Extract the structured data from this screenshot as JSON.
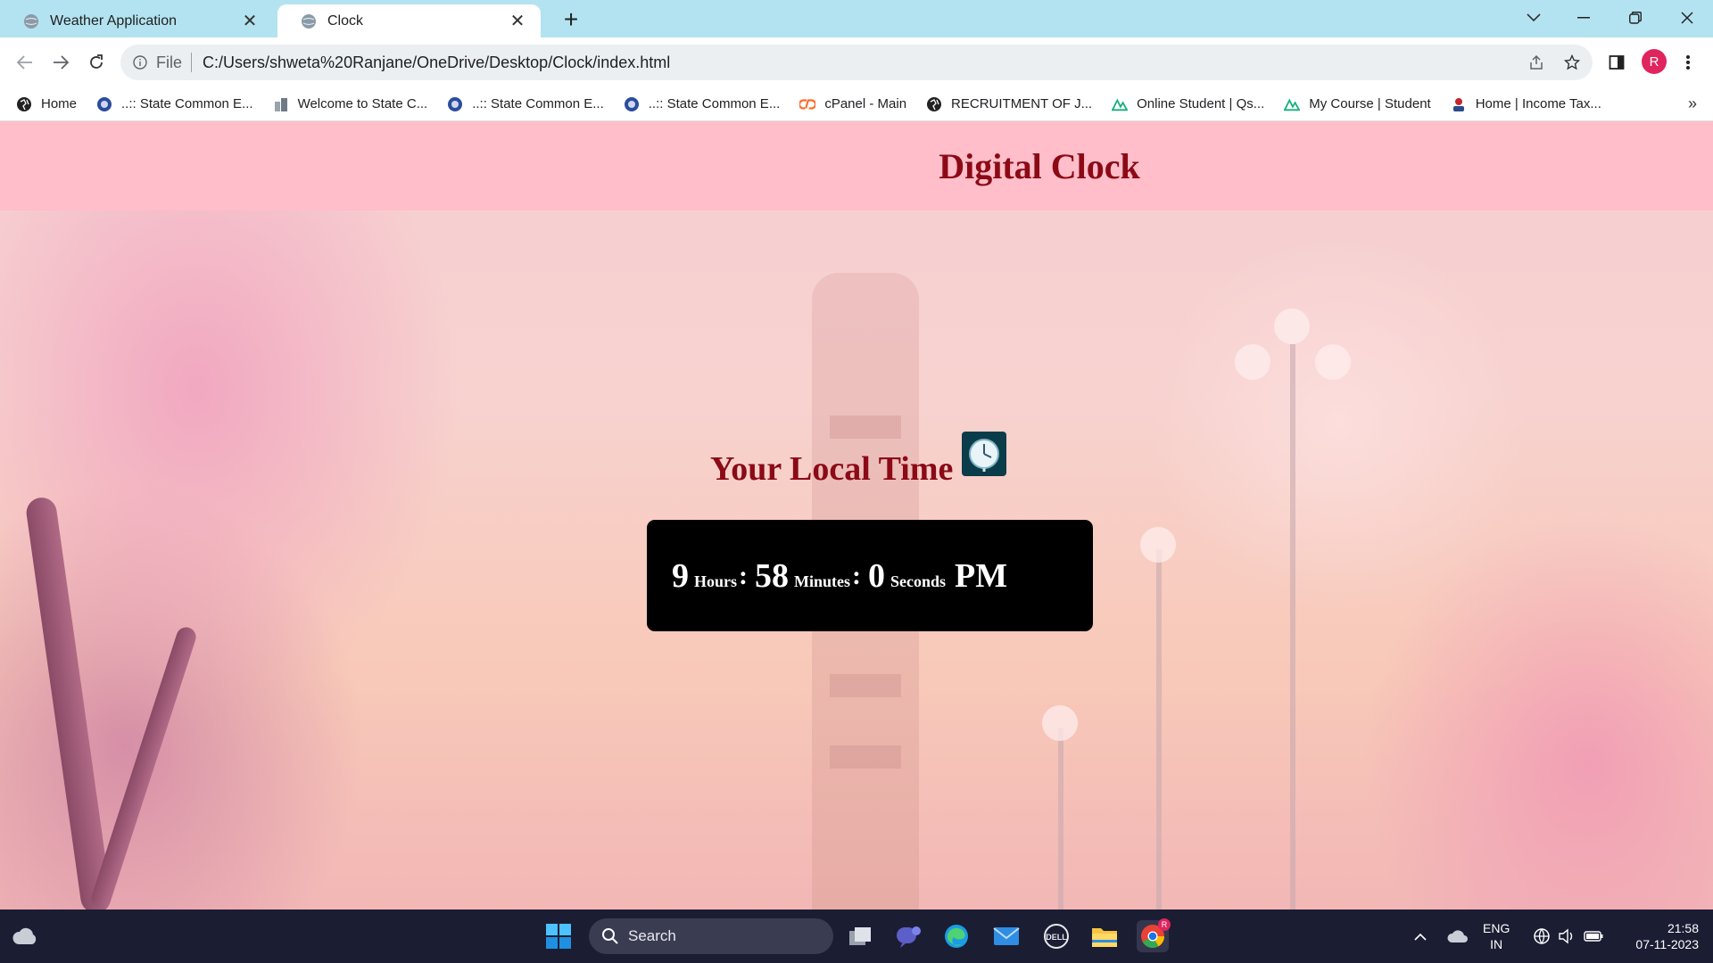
{
  "browser": {
    "tabs": [
      {
        "title": "Weather Application",
        "active": false
      },
      {
        "title": "Clock",
        "active": true
      }
    ],
    "address": {
      "scheme_label": "File",
      "url": "C:/Users/shweta%20Ranjane/OneDrive/Desktop/Clock/index.html"
    },
    "profile_initial": "R",
    "bookmarks": [
      {
        "label": "Home",
        "icon": "globe-icon"
      },
      {
        "label": "..:: State Common E...",
        "icon": "seal-icon"
      },
      {
        "label": "Welcome to State C...",
        "icon": "building-icon"
      },
      {
        "label": "..:: State Common E...",
        "icon": "seal-icon"
      },
      {
        "label": "..:: State Common E...",
        "icon": "seal-icon"
      },
      {
        "label": "cPanel - Main",
        "icon": "cpanel-icon"
      },
      {
        "label": "RECRUITMENT OF J...",
        "icon": "globe-icon"
      },
      {
        "label": "Online Student | Qs...",
        "icon": "qspiders-icon"
      },
      {
        "label": "My Course | Student",
        "icon": "qspiders-icon"
      },
      {
        "label": "Home | Income Tax...",
        "icon": "incometax-icon"
      }
    ],
    "bookmarks_more": "»"
  },
  "page": {
    "header_title": "Digital Clock",
    "subtitle": "Your Local Time",
    "clock": {
      "hours": "9",
      "hours_label": "Hours",
      "minutes": "58",
      "minutes_label": "Minutes",
      "seconds": "0",
      "seconds_label": "Seconds",
      "separator": ":",
      "period": "PM"
    }
  },
  "taskbar": {
    "search_label": "Search",
    "language": "ENG",
    "region": "IN",
    "time": "21:58",
    "date": "07-11-2023",
    "chrome_badge": "R"
  },
  "colors": {
    "tab_strip": "#b3e3f0",
    "header_banner": "#ffbec9",
    "title_text": "#8b0a16",
    "clock_box": "#000000",
    "taskbar": "#1b1d33"
  }
}
